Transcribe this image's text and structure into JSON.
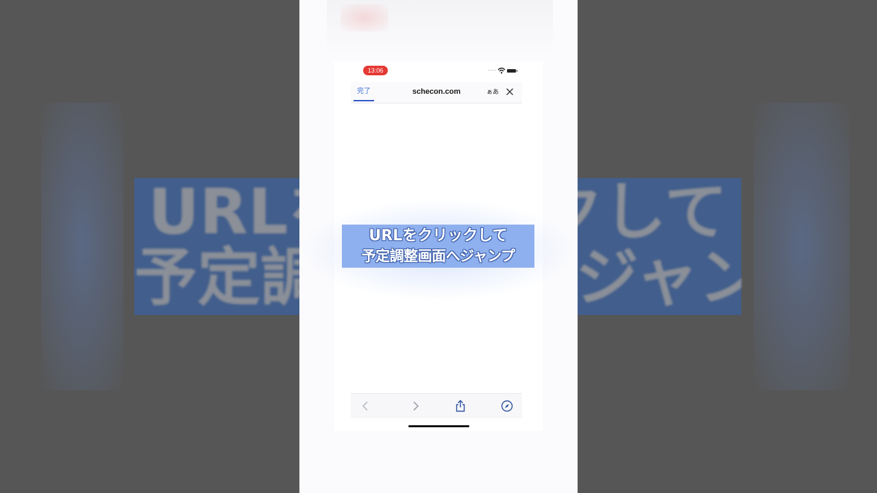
{
  "status_bar": {
    "time": "13:06"
  },
  "nav_bar": {
    "done_label": "完了",
    "url": "schecon.com",
    "text_size_label": "ぁあ"
  },
  "caption": {
    "line1": "URLをクリックして",
    "line2": "予定調整画面へジャンプ"
  },
  "background_banner": {
    "line1": "URLをクリックして",
    "line2": "予定調整画面へジャンプ"
  },
  "icons": {
    "close": "close-icon",
    "back": "chevron-left-icon",
    "forward": "chevron-right-icon",
    "share": "share-icon",
    "compass": "compass-icon",
    "wifi": "wifi-icon",
    "battery": "battery-icon",
    "signal": "signal-icon"
  },
  "colors": {
    "time_pill": "#e53935",
    "link_blue": "#3b6fd0",
    "caption_bg": "#8fb0ef",
    "banner_bg": "#3e5f95"
  }
}
